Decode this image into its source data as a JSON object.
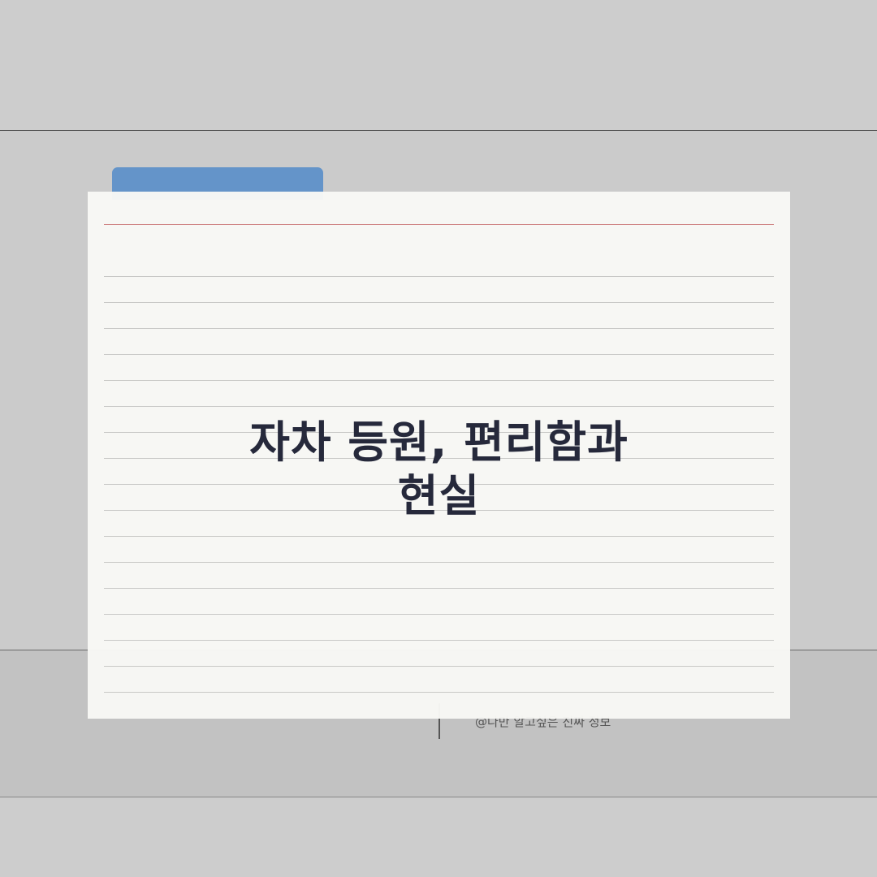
{
  "title": {
    "line1": "자차 등원, 편리함과",
    "line2": "현실"
  },
  "footer": {
    "watermark": "@나만 알고싶은 진짜 정보"
  },
  "colors": {
    "background": "#cbcbcb",
    "tab": "#6494c9",
    "card": "#f8f8f5",
    "margin_line": "#cf8383",
    "title_text": "#26293b"
  }
}
